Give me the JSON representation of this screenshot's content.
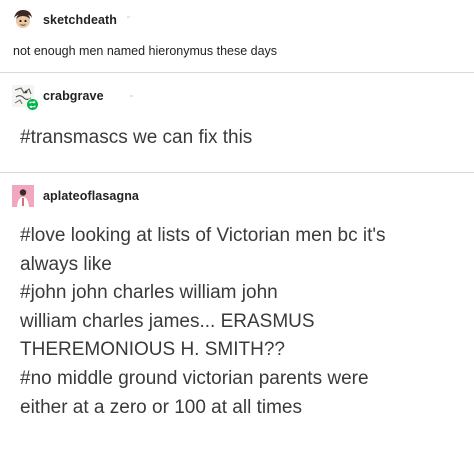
{
  "posts": [
    {
      "username": "sketchdeath",
      "avatar_icon": "cartoon-face-avatar-icon",
      "text": "not enough men named hieronymus these days"
    },
    {
      "username": "crabgrave",
      "avatar_icon": "doodle-avatar-icon",
      "reblog_badge_icon": "reblog-badge-icon",
      "text": "#transmascs we can fix this"
    },
    {
      "username": "aplateoflasagna",
      "avatar_icon": "figure-avatar-icon",
      "lines": [
        "#love looking at lists of Victorian men bc it's",
        "always like",
        "#john john charles william john",
        "william charles james... ERASMUS",
        "THEREMONIOUS H. SMITH??",
        "#no middle ground victorian parents were",
        "either at a zero or 100 at all times"
      ]
    }
  ],
  "colors": {
    "divider": "#d9d9d9",
    "reblog_badge": "#00b34a",
    "avatar3_bg": "#f2a7c0"
  }
}
